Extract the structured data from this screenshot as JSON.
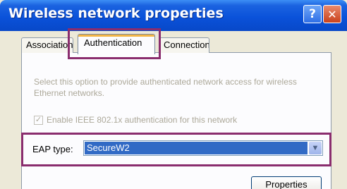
{
  "window": {
    "title": "Wireless network properties",
    "help_icon": "?",
    "close_icon": "✕"
  },
  "tabs": [
    {
      "label": "Association",
      "selected": false
    },
    {
      "label": "Authentication",
      "selected": true
    },
    {
      "label": "Connection",
      "selected": false
    }
  ],
  "panel": {
    "description": "Select this option to provide authenticated network access for wireless Ethernet networks.",
    "enable_8021x": {
      "label": "Enable IEEE 802.1x authentication for this network",
      "checked": true,
      "disabled": true
    },
    "eap_type": {
      "label": "EAP type:",
      "value": "SecureW2"
    },
    "properties_button": "Properties"
  },
  "colors": {
    "highlight_box": "#8a2d6e",
    "titlebar": "#0a52da",
    "selection": "#316ac5"
  }
}
